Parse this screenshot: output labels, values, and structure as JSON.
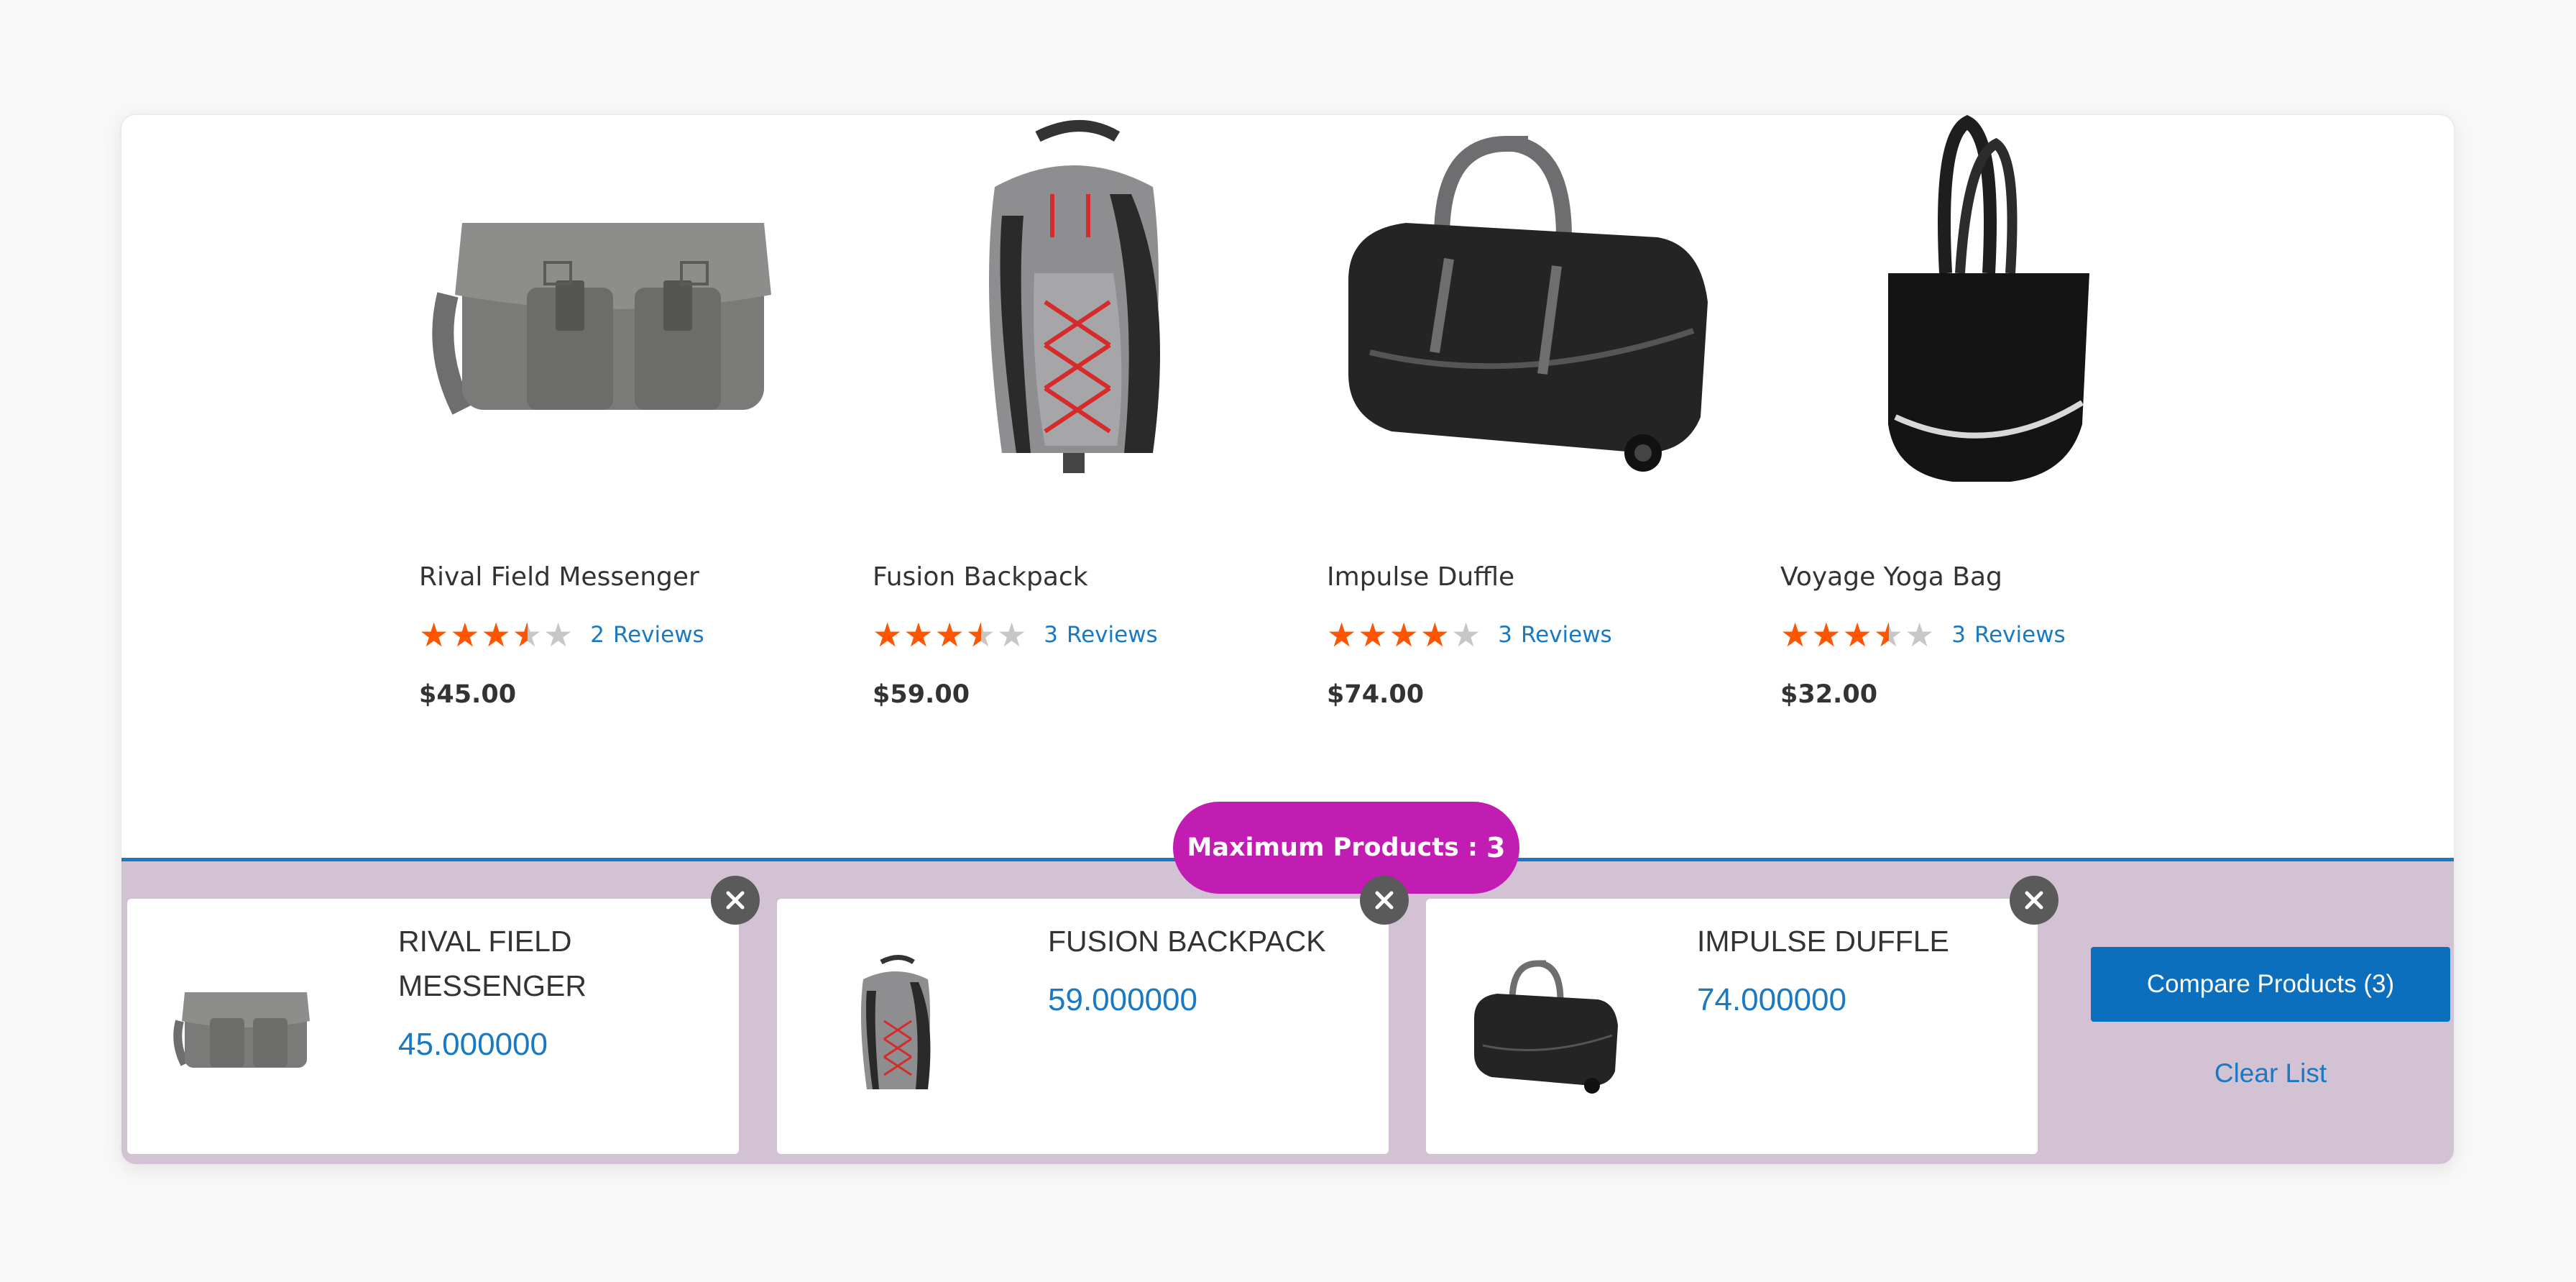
{
  "products": [
    {
      "name": "Rival Field Messenger",
      "rating_fraction": 0.7,
      "review_count": "2",
      "reviews_label": "Reviews",
      "price": "$45.00"
    },
    {
      "name": "Fusion Backpack",
      "rating_fraction": 0.7,
      "review_count": "3",
      "reviews_label": "Reviews",
      "price": "$59.00"
    },
    {
      "name": "Impulse Duffle",
      "rating_fraction": 0.8,
      "review_count": "3",
      "reviews_label": "Reviews",
      "price": "$74.00"
    },
    {
      "name": "Voyage Yoga Bag",
      "rating_fraction": 0.7,
      "review_count": "3",
      "reviews_label": "Reviews",
      "price": "$32.00"
    }
  ],
  "compare_bar": {
    "badge_label": "Maximum Products :",
    "badge_value": "3",
    "items": [
      {
        "name": "RIVAL FIELD MESSENGER",
        "price": "45.000000"
      },
      {
        "name": "FUSION BACKPACK",
        "price": "59.000000"
      },
      {
        "name": "IMPULSE DUFFLE",
        "price": "74.000000"
      }
    ],
    "compare_button_label": "Compare Products (3)",
    "clear_link_label": "Clear List"
  },
  "icons": {
    "star": "★",
    "remove": "close-icon"
  },
  "colors": {
    "star_fill": "#ff5501",
    "star_empty": "#c7c7c7",
    "link_blue": "#1979c3",
    "badge_magenta": "#c21db3",
    "compare_bar_bg": "#d3c2d4",
    "button_blue": "#0c6fbd"
  }
}
